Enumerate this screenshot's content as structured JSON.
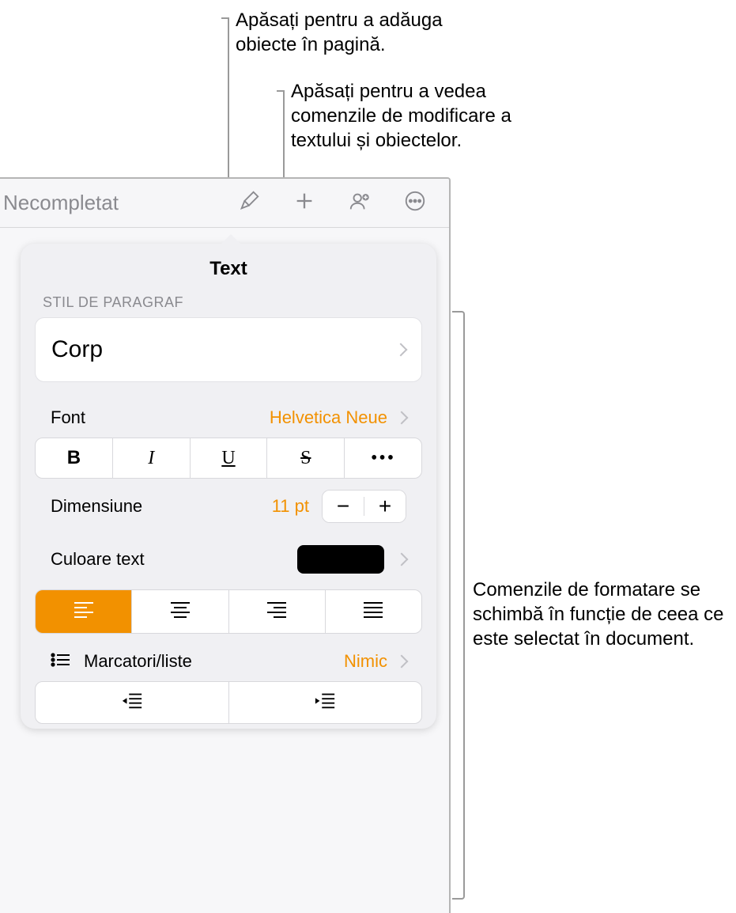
{
  "callouts": {
    "add_objects": "Apăsați pentru a adăuga obiecte în pagină.",
    "edit_controls": "Apăsați pentru a vedea comenzile de modificare a textului și obiectelor.",
    "format_context": "Comenzile de formatare se schimbă în funcție de ceea ce este selectat în document."
  },
  "toolbar": {
    "doc_title": "Necompletat",
    "icons": {
      "format": "paintbrush-icon",
      "insert": "plus-icon",
      "collaborate": "collaborate-icon",
      "more": "ellipsis-circle-icon"
    }
  },
  "popover": {
    "title": "Text",
    "paragraph_style_label": "STIL DE PARAGRAF",
    "paragraph_style_value": "Corp",
    "font_label": "Font",
    "font_value": "Helvetica Neue",
    "style_buttons": {
      "bold": "B",
      "italic": "I",
      "underline": "U",
      "strike": "S",
      "more": "•••"
    },
    "size_label": "Dimensiune",
    "size_value": "11 pt",
    "stepper": {
      "minus": "−",
      "plus": "+"
    },
    "text_color_label": "Culoare text",
    "text_color_value": "#000000",
    "alignment_active": "left",
    "bullets_label": "Marcatori/liste",
    "bullets_value": "Nimic"
  }
}
